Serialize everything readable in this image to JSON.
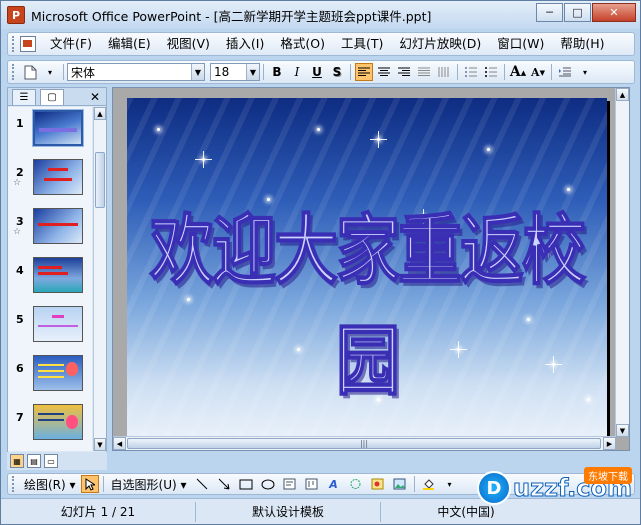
{
  "window": {
    "title": "Microsoft Office PowerPoint - [高二新学期开学主题班会ppt课件.ppt]",
    "app_icon": "P",
    "minimize": "─",
    "maximize": "□",
    "close": "✕"
  },
  "menu": [
    {
      "label": "文件(F)"
    },
    {
      "label": "编辑(E)"
    },
    {
      "label": "视图(V)"
    },
    {
      "label": "插入(I)"
    },
    {
      "label": "格式(O)"
    },
    {
      "label": "工具(T)"
    },
    {
      "label": "幻灯片放映(D)"
    },
    {
      "label": "窗口(W)"
    },
    {
      "label": "帮助(H)"
    }
  ],
  "toolbar": {
    "font_name": "宋体",
    "font_size": "18",
    "bold": "B",
    "italic": "I",
    "underline": "U",
    "shadow": "S",
    "grow_font": "A",
    "shrink_font": "A"
  },
  "panel": {
    "tab_outline": "☰",
    "tab_slides": "▢",
    "close": "✕"
  },
  "thumbnails": [
    {
      "num": "1",
      "star": "",
      "selected": true
    },
    {
      "num": "2",
      "star": "☆",
      "selected": false
    },
    {
      "num": "3",
      "star": "☆",
      "selected": false
    },
    {
      "num": "4",
      "star": "",
      "selected": false
    },
    {
      "num": "5",
      "star": "",
      "selected": false
    },
    {
      "num": "6",
      "star": "",
      "selected": false
    },
    {
      "num": "7",
      "star": "",
      "selected": false
    }
  ],
  "slide": {
    "title": "欢迎大家重返校园"
  },
  "drawbar": {
    "draw_label": "绘图(R)",
    "autoshapes_label": "自选图形(U)"
  },
  "status": {
    "slide_info": "幻灯片 1 / 21",
    "design": "默认设计模板",
    "language": "中文(中国)"
  },
  "watermark": {
    "brand": "uzzf.com",
    "circle": "D",
    "tag": "东坡下载"
  },
  "colors": {
    "accent_highlight": "#ffc46b",
    "slide_title_outline": "#3a2fb4"
  }
}
